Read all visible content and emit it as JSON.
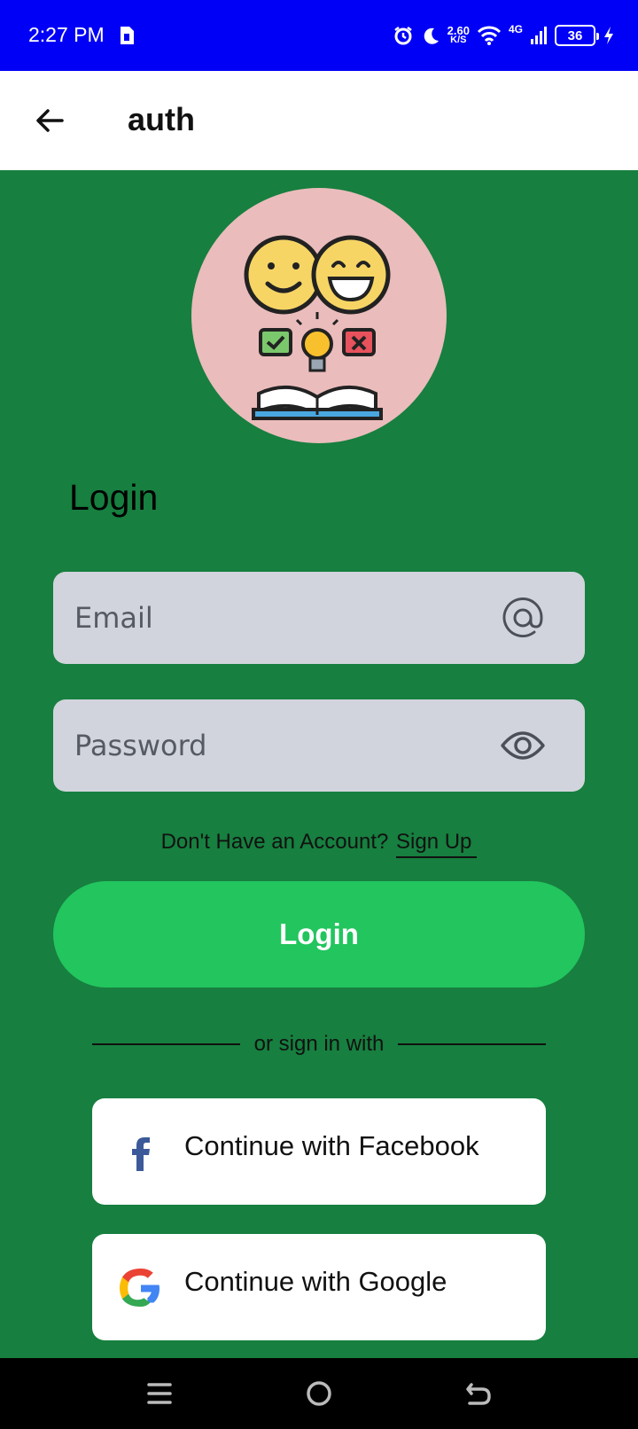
{
  "status_bar": {
    "time": "2:27 PM",
    "net_speed_value": "2.60",
    "net_speed_unit": "K/S",
    "network_type": "4G",
    "battery": "36"
  },
  "app_bar": {
    "title": "auth",
    "back_icon": "arrow-left-icon"
  },
  "login": {
    "heading": "Login",
    "email_placeholder": "Email",
    "email_icon": "at-sign-icon",
    "password_placeholder": "Password",
    "password_icon": "eye-icon",
    "no_account_text": "Don't Have an Account?",
    "signup_link": "Sign Up",
    "login_button": "Login",
    "divider_text": "or sign in with",
    "facebook_button": "Continue with Facebook",
    "google_button": "Continue with Google"
  },
  "colors": {
    "status_bar": "#0100f7",
    "background": "#177f3f",
    "primary_button": "#22c55e",
    "input_bg": "#d1d4dc",
    "avatar_bg": "#ebbcbc"
  }
}
